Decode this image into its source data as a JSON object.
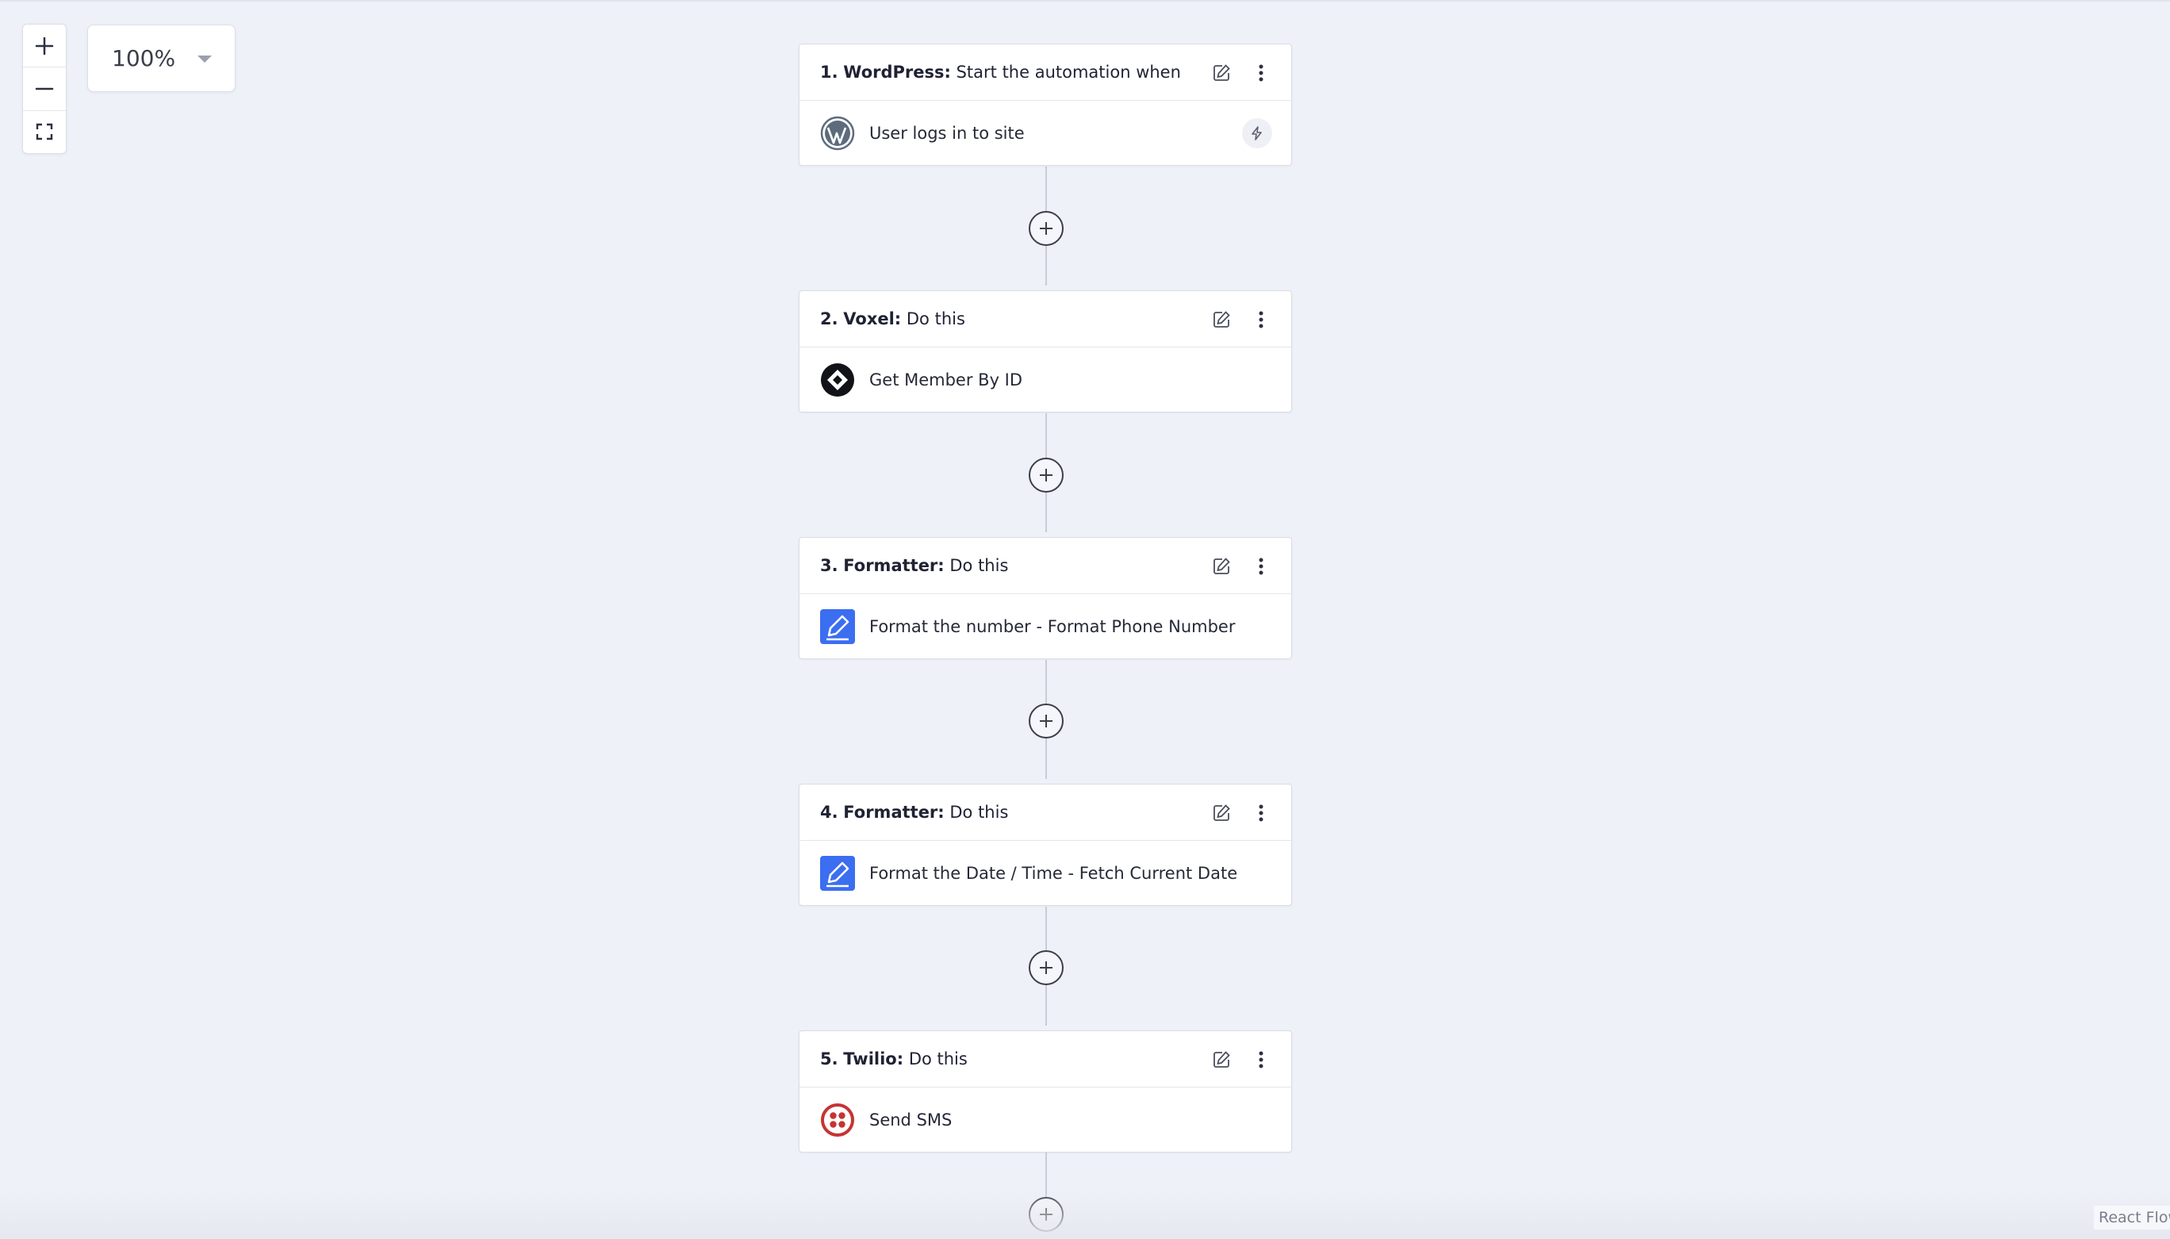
{
  "zoom": {
    "value": "100%"
  },
  "controls": {
    "zoom_in_icon": "plus-icon",
    "zoom_out_icon": "minus-icon",
    "fit_view_icon": "fullscreen-icon"
  },
  "steps": [
    {
      "number": "1.",
      "app": "WordPress:",
      "action_type": "Start the automation when",
      "event": "User logs in to site",
      "icon": "wordpress-logo",
      "trigger_icon": "bolt-icon"
    },
    {
      "number": "2.",
      "app": "Voxel:",
      "action_type": "Do this",
      "event": "Get Member By ID",
      "icon": "voxel-logo"
    },
    {
      "number": "3.",
      "app": "Formatter:",
      "action_type": "Do this",
      "event": "Format the number - Format Phone Number",
      "icon": "formatter-logo"
    },
    {
      "number": "4.",
      "app": "Formatter:",
      "action_type": "Do this",
      "event": "Format the Date / Time - Fetch Current Date",
      "icon": "formatter-logo"
    },
    {
      "number": "5.",
      "app": "Twilio:",
      "action_type": "Do this",
      "event": "Send SMS",
      "icon": "twilio-logo"
    }
  ],
  "attribution": "React Flow",
  "colors": {
    "canvas": "#eef1f8",
    "formatter_blue": "#3b6ef0",
    "twilio_red": "#c63333",
    "wordpress_gray": "#5d6b7d"
  }
}
